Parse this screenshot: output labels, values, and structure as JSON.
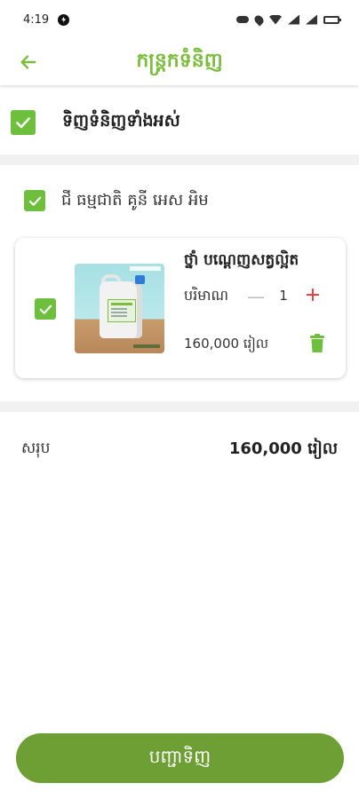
{
  "status_bar": {
    "time": "4:19",
    "icons": [
      "vpn-key-icon",
      "location-icon",
      "wifi-icon",
      "signal-icon",
      "signal-icon",
      "battery-icon"
    ]
  },
  "app_bar": {
    "title": "កន្ត្រកទំនិញ",
    "back_icon": "arrow-left-icon"
  },
  "select_all": {
    "label": "ទិញទំនិញទាំងអស់",
    "checked": true
  },
  "cart": {
    "store": {
      "name": "ជី ធម្មជាតិ គូនី អេស អិម",
      "checked": true
    },
    "items": [
      {
        "name": "ថ្នាំ បណ្តេញសត្វល្អិត",
        "quantity_label": "បរិមាណ",
        "quantity": "1",
        "price": "160,000 រៀល",
        "checked": true
      }
    ]
  },
  "summary": {
    "total_label": "សរុប",
    "total_value": "160,000 រៀល"
  },
  "checkout": {
    "label": "បញ្ជាទិញ"
  },
  "colors": {
    "accent": "#7cbd3d",
    "checkbox": "#6fbf3e",
    "button": "#6e9f34",
    "plus": "#e53935"
  }
}
